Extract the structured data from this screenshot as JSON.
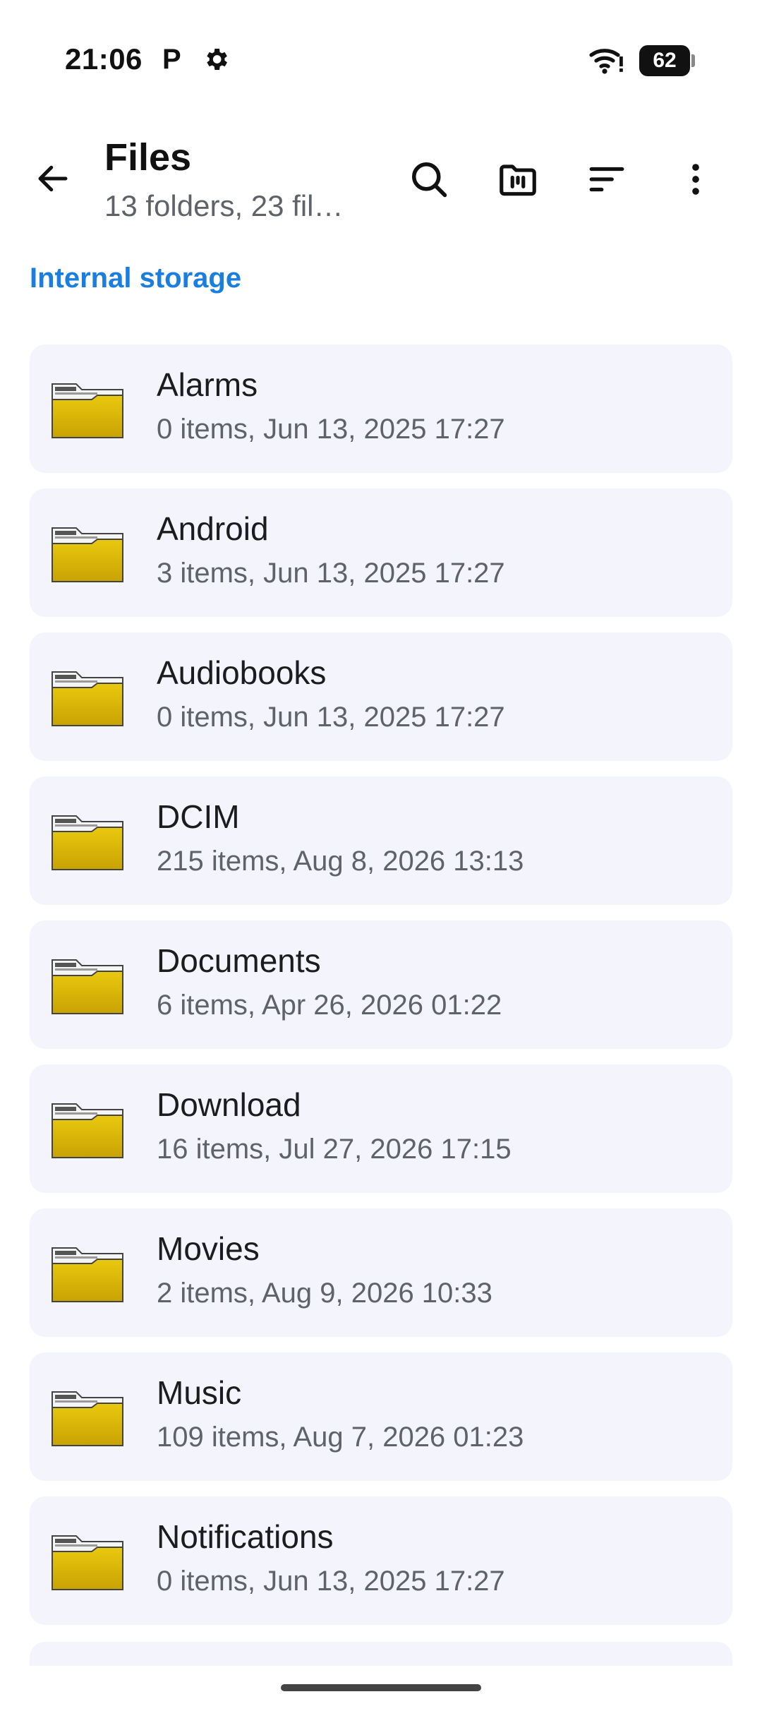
{
  "status_bar": {
    "time": "21:06",
    "notification_icon_letter": "P",
    "battery_level": "62",
    "icons": [
      "parking-icon",
      "gear-icon",
      "wifi-icon",
      "battery-icon"
    ]
  },
  "app_bar": {
    "title": "Files",
    "subtitle": "13 folders, 23 fil…",
    "actions": [
      "back-icon",
      "search-icon",
      "storage-icon",
      "sort-icon",
      "more-vert-icon"
    ]
  },
  "storage": {
    "label": "Internal storage",
    "accent_color": "#1a7ee0"
  },
  "folders": [
    {
      "name": "Alarms",
      "meta": "0 items, Jun 13, 2025 17:27"
    },
    {
      "name": "Android",
      "meta": "3 items, Jun 13, 2025 17:27"
    },
    {
      "name": "Audiobooks",
      "meta": "0 items, Jun 13, 2025 17:27"
    },
    {
      "name": "DCIM",
      "meta": "215 items, Aug 8, 2026 13:13"
    },
    {
      "name": "Documents",
      "meta": "6 items, Apr 26, 2026 01:22"
    },
    {
      "name": "Download",
      "meta": "16 items, Jul 27, 2026 17:15"
    },
    {
      "name": "Movies",
      "meta": "2 items, Aug 9, 2026 10:33"
    },
    {
      "name": "Music",
      "meta": "109 items, Aug 7, 2026 01:23"
    },
    {
      "name": "Notifications",
      "meta": "0 items, Jun 13, 2025 17:27"
    }
  ],
  "colors": {
    "row_background": "#f3f4fc",
    "folder_yellow": "#d8b90a"
  }
}
